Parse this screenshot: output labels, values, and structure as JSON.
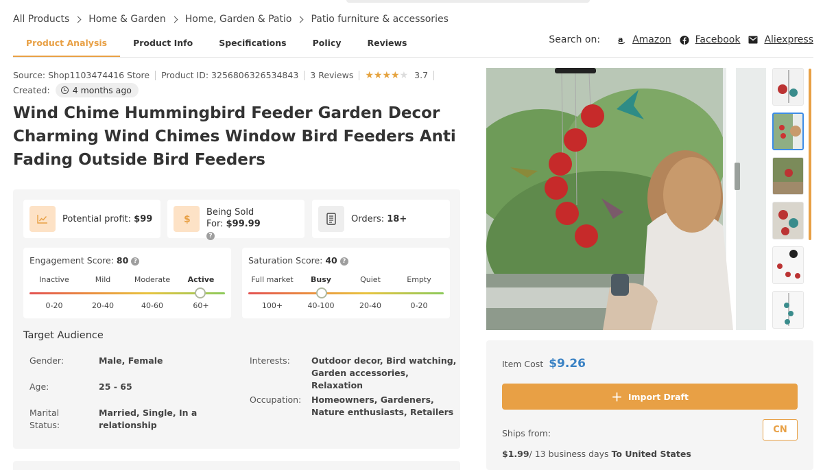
{
  "breadcrumb": [
    "All Products",
    "Home & Garden",
    "Home, Garden & Patio",
    "Patio furniture & accessories"
  ],
  "tabs": [
    "Product Analysis",
    "Product Info",
    "Specifications",
    "Policy",
    "Reviews"
  ],
  "search_on": {
    "label": "Search on:",
    "sites": [
      {
        "name": "Amazon",
        "icon": "amazon-icon"
      },
      {
        "name": "Facebook",
        "icon": "facebook-icon"
      },
      {
        "name": "Aliexpress",
        "icon": "mail-icon"
      }
    ]
  },
  "meta": {
    "source": "Source: Shop1103474416 Store",
    "product_id": "Product ID: 3256806326534843",
    "reviews": "3 Reviews",
    "rating": "3.7",
    "rating_value": 3.7,
    "created_label": "Created:",
    "created_value": "4 months ago"
  },
  "title": "Wind Chime Hummingbird Feeder Garden Decor Charming Wind Chimes Window Bird Feeders Anti Fading Outside Bird Feeders",
  "stats": {
    "profit_label": "Potential profit:",
    "profit_value": "$99",
    "sold_label": "Being Sold For:",
    "sold_value": "$99.99",
    "orders_label": "Orders:",
    "orders_value": "18+",
    "help_mark": "?"
  },
  "engagement": {
    "label": "Engagement Score:",
    "value": "80",
    "levels": [
      "Inactive",
      "Mild",
      "Moderate",
      "Active"
    ],
    "ranges": [
      "0-20",
      "20-40",
      "40-60",
      "60+"
    ],
    "active_index": 3,
    "level_fraction": 0.875
  },
  "saturation": {
    "label": "Saturation Score:",
    "value": "40",
    "levels": [
      "Full market",
      "Busy",
      "Quiet",
      "Empty"
    ],
    "ranges": [
      "100+",
      "40-100",
      "20-40",
      "0-20"
    ],
    "active_index": 1,
    "level_fraction": 0.375
  },
  "audience": {
    "title": "Target Audience",
    "gender_label": "Gender:",
    "gender_value": "Male, Female",
    "age_label": "Age:",
    "age_value": "25 - 65",
    "marital_label_1": "Marital",
    "marital_label_2": "Status:",
    "marital_value_1": "Married, Single, In a",
    "marital_value_2": "relationship",
    "interests_label": "Interests:",
    "interests_value_1": "Outdoor decor, Bird watching,",
    "interests_value_2": "Garden accessories, Relaxation",
    "occupation_label": "Occupation:",
    "occupation_value_1": "Homeowners, Gardeners,",
    "occupation_value_2": "Nature enthusiasts, Retailers"
  },
  "buy": {
    "item_cost_label": "Item Cost",
    "item_cost_value": "$9.26",
    "import_label": "Import Draft",
    "ships_from_label": "Ships from:",
    "ships_from_value": "CN",
    "ship_price": "$1.99",
    "ship_days": "/ 13 business days",
    "ship_dest": "To United States"
  },
  "colors": {
    "accent": "#e8a045",
    "link_blue": "#3a82c4",
    "star": "#e5a33f"
  }
}
